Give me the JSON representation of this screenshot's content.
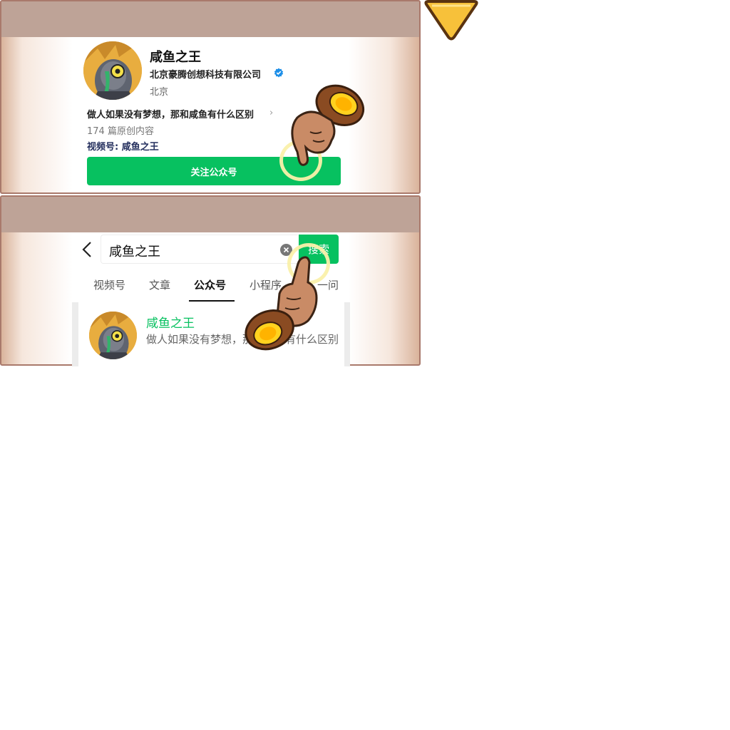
{
  "profile": {
    "name": "咸鱼之王",
    "company": "北京豪腾创想科技有限公司",
    "city": "北京",
    "intro": "做人如果没有梦想，那和咸鱼有什么区别",
    "chevron": "›",
    "article_count": "174 篇原创内容",
    "channel": "视频号: 咸鱼之王",
    "follow_button": "关注公众号"
  },
  "search": {
    "back_icon": "chevron-left-icon",
    "query": "咸鱼之王",
    "clear_icon": "clear-circle-icon",
    "search_button": "搜索",
    "tabs": [
      {
        "label": "视频号",
        "active": false
      },
      {
        "label": "文章",
        "active": false
      },
      {
        "label": "公众号",
        "active": true
      },
      {
        "label": "小程序",
        "active": false
      },
      {
        "label": "一问",
        "active": false
      }
    ],
    "result": {
      "title": "咸鱼之王",
      "description": "做人如果没有梦想，那和咸鱼有什么区别"
    }
  },
  "colors": {
    "brand_green": "#07c160",
    "panel_header": "#bea397",
    "panel_border": "#a9796b",
    "arrow_fill": "#f7c13a",
    "verify_blue": "#1e8fe8"
  },
  "icons": [
    "chevron-left-icon",
    "clear-circle-icon",
    "verified-badge-icon",
    "pointing-hand-icon",
    "down-arrow-icon"
  ]
}
